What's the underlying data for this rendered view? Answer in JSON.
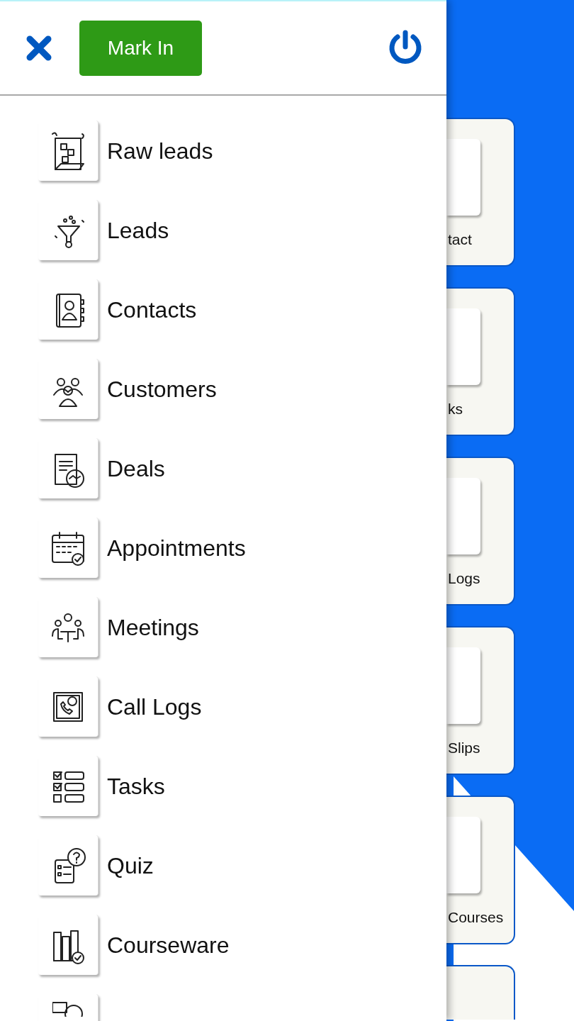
{
  "drawer": {
    "mark_in_button": "Mark In",
    "menu_items": [
      {
        "label": "Raw leads"
      },
      {
        "label": "Leads"
      },
      {
        "label": "Contacts"
      },
      {
        "label": "Customers"
      },
      {
        "label": "Deals"
      },
      {
        "label": "Appointments"
      },
      {
        "label": "Meetings"
      },
      {
        "label": "Call Logs"
      },
      {
        "label": "Tasks"
      },
      {
        "label": "Quiz"
      },
      {
        "label": "Courseware"
      }
    ]
  },
  "background_cards": [
    {
      "label": "tact"
    },
    {
      "label": "ks"
    },
    {
      "label": "Logs"
    },
    {
      "label": "Slips"
    },
    {
      "label": "Courses"
    }
  ]
}
